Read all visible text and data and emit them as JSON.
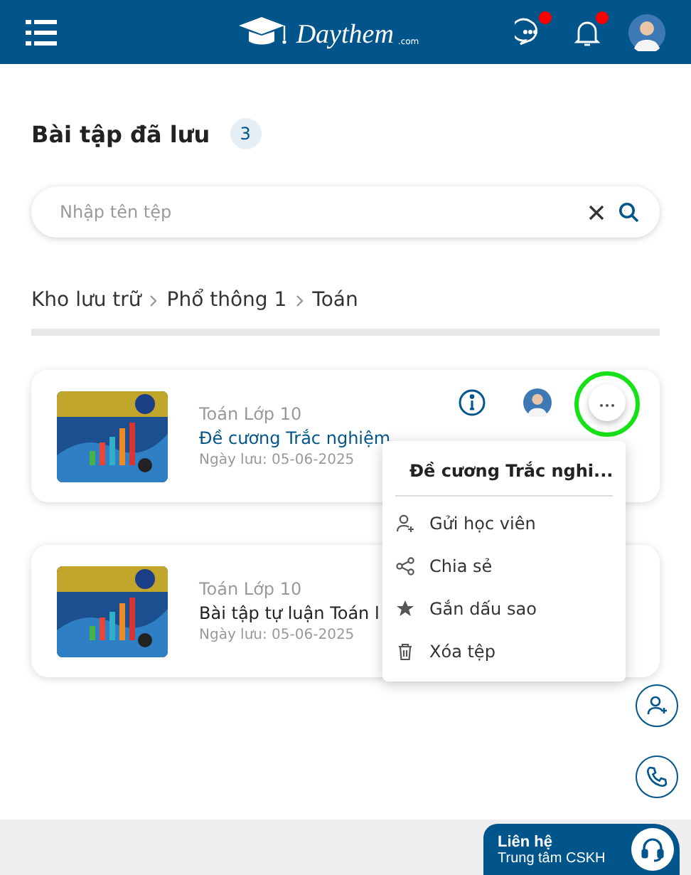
{
  "header": {
    "logo": "Daythem",
    "logo_suffix": ".com",
    "chat_unread": true,
    "notifications_unread": true
  },
  "page_title": "Bài tập đã lưu",
  "count": "3",
  "search": {
    "placeholder": "Nhập tên tệp"
  },
  "breadcrumb": [
    "Kho lưu trữ",
    "Phổ thông 1",
    "Toán"
  ],
  "files": [
    {
      "subject": "Toán Lớp 10",
      "title": "Đề cương Trắc nghiệm",
      "date": "Ngày lưu: 05-06-2025",
      "selected": true,
      "highlighted": true
    },
    {
      "subject": "Toán Lớp 10",
      "title": "Bài tập tự luận Toán l",
      "date": "Ngày lưu: 05-06-2025",
      "selected": false
    }
  ],
  "menu": {
    "title": "Đề cương Trắc nghi...",
    "items": [
      {
        "kind": "send",
        "label": "Gửi học viên"
      },
      {
        "kind": "share",
        "label": "Chia sẻ"
      },
      {
        "kind": "star",
        "label": "Gắn dấu sao"
      },
      {
        "kind": "delete",
        "label": "Xóa tệp"
      }
    ]
  },
  "contact": {
    "title": "Liên hệ",
    "subtitle": "Trung tâm CSKH"
  }
}
